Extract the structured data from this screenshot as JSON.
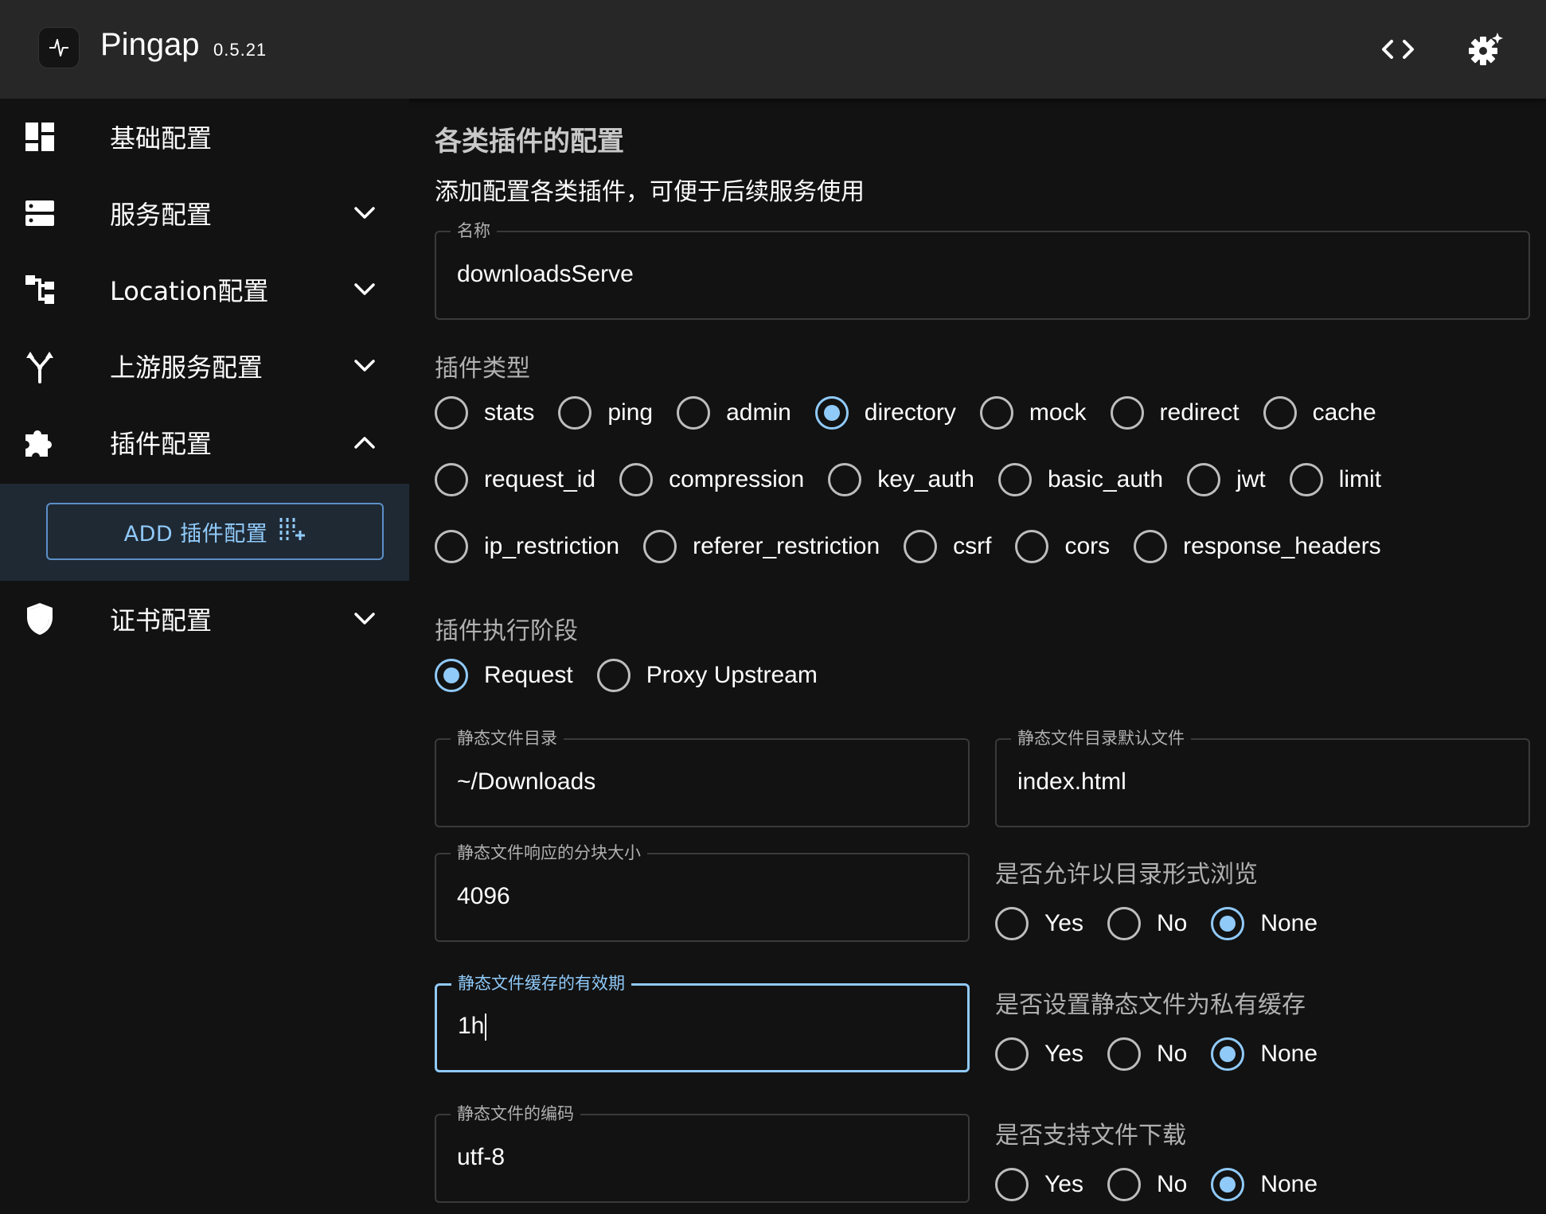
{
  "app": {
    "title": "Pingap",
    "version": "0.5.21"
  },
  "sidebar": {
    "items": [
      {
        "label": "基础配置",
        "icon": "dashboard-icon"
      },
      {
        "label": "服务配置",
        "icon": "server-icon"
      },
      {
        "label": "Location配置",
        "icon": "tree-icon"
      },
      {
        "label": "上游服务配置",
        "icon": "fork-icon"
      },
      {
        "label": "插件配置",
        "icon": "puzzle-icon"
      },
      {
        "label": "证书配置",
        "icon": "shield-icon"
      }
    ],
    "add_button": "ADD 插件配置"
  },
  "main": {
    "title": "各类插件的配置",
    "subtitle": "添加配置各类插件，可便于后续服务使用",
    "name_field": {
      "label": "名称",
      "value": "downloadsServe"
    },
    "plugin_type": {
      "label": "插件类型",
      "selected": "directory",
      "rows": [
        [
          "stats",
          "ping",
          "admin",
          "directory",
          "mock",
          "redirect",
          "cache"
        ],
        [
          "request_id",
          "compression",
          "key_auth",
          "basic_auth",
          "jwt",
          "limit"
        ],
        [
          "ip_restriction",
          "referer_restriction",
          "csrf",
          "cors",
          "response_headers"
        ]
      ]
    },
    "step": {
      "label": "插件执行阶段",
      "options": [
        "Request",
        "Proxy Upstream"
      ],
      "selected": "Request"
    },
    "dir_field": {
      "label": "静态文件目录",
      "value": "~/Downloads"
    },
    "index_field": {
      "label": "静态文件目录默认文件",
      "value": "index.html"
    },
    "chunk_field": {
      "label": "静态文件响应的分块大小",
      "value": "4096"
    },
    "max_age_field": {
      "label": "静态文件缓存的有效期",
      "value": "1h"
    },
    "charset_field": {
      "label": "静态文件的编码",
      "value": "utf-8"
    },
    "autoindex": {
      "label": "是否允许以目录形式浏览",
      "options": [
        "Yes",
        "No",
        "None"
      ],
      "selected": "None"
    },
    "private_cache": {
      "label": "是否设置静态文件为私有缓存",
      "options": [
        "Yes",
        "No",
        "None"
      ],
      "selected": "None"
    },
    "download": {
      "label": "是否支持文件下载",
      "options": [
        "Yes",
        "No",
        "None"
      ],
      "selected": "None"
    }
  },
  "colors": {
    "accent": "#90caf9",
    "topbar": "#272727",
    "background": "#121212",
    "submenu_bg": "#1f2934"
  }
}
